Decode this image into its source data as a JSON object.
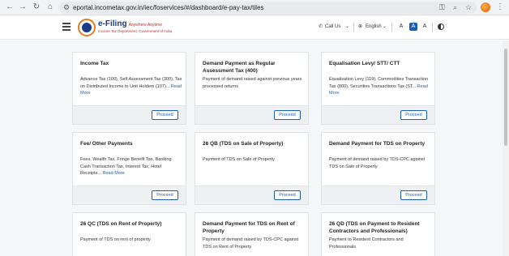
{
  "browser": {
    "url": "eportal.incometax.gov.in/iec/foservices/#/dashboard/e-pay-tax/tiles",
    "nav_icons": [
      "back-arrow-icon",
      "forward-arrow-icon",
      "reload-icon",
      "home-icon"
    ]
  },
  "header": {
    "brand": "e-Filing",
    "brand_tagline": "Anywhere Anytime",
    "brand_sub": "Income Tax Department, Government of India",
    "call_us": "Call Us",
    "language": "English",
    "font_decrease": "A",
    "font_normal": "A",
    "font_increase": "A",
    "accent_color": "#1a5fb4"
  },
  "cards": [
    {
      "title": "Income Tax",
      "desc": "Advance Tax (100), Self Assessment Tax (300), Tax on Distributed Income to Unit Holders (107)...",
      "read_more": "Read More",
      "button": "Proceed"
    },
    {
      "title": "Demand Payment as Regular Assessment Tax (400)",
      "desc": "Payment of demand raised against previous years processed returns",
      "read_more": "",
      "button": "Proceed"
    },
    {
      "title": "Equalisation Levy/ STT/ CTT",
      "desc": "Equalisation Levy (119), Commodities Transaction Tax (800), Securities Transactions Tax (ST...",
      "read_more": "Read More",
      "button": "Proceed"
    },
    {
      "title": "Fee/ Other Payments",
      "desc": "Fees, Wealth Tax, Fringe Benefit Tax, Banking Cash Transaction Tax, Interest Tax, Hotel Receipts...",
      "read_more": "Read More",
      "button": "Proceed"
    },
    {
      "title": "26 QB (TDS on Sale of Property)",
      "desc": "Payment of TDS on Sale of Property",
      "read_more": "",
      "button": "Proceed"
    },
    {
      "title": "Demand Payment for TDS on Property",
      "desc": "Payment of demand raised by TDS-CPC against TDS on Sale of Property",
      "read_more": "",
      "button": "Proceed"
    },
    {
      "title": "26 QC (TDS on Rent of Property)",
      "desc": "Payment of TDS on rent of property",
      "read_more": "",
      "button": ""
    },
    {
      "title": "Demand Payment for TDS on Rent of Property",
      "desc": "Payment of demand raised by TDS-CPC against TDS on Rent of Property",
      "read_more": "",
      "button": ""
    },
    {
      "title": "26 QD (TDS on Payment to Resident Contractors and Professionals)",
      "desc": "Payment to Resident Contractors and Professionals",
      "read_more": "",
      "button": ""
    }
  ]
}
